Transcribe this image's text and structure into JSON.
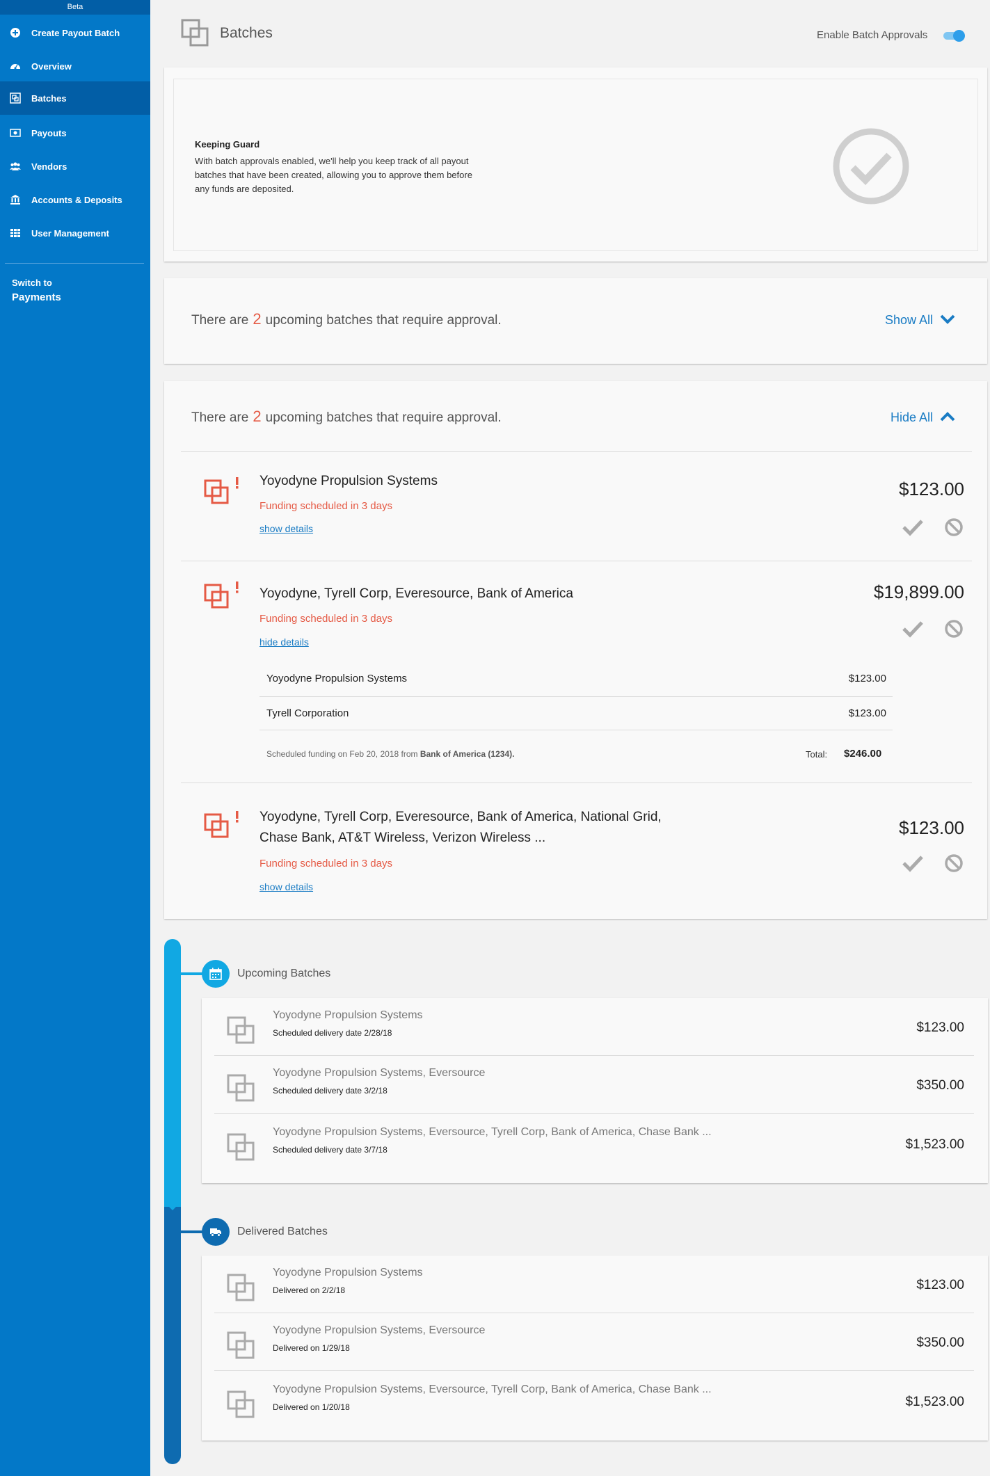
{
  "sidebar": {
    "beta": "Beta",
    "items": [
      {
        "label": "Create Payout Batch",
        "icon": "plus-circle-icon"
      },
      {
        "label": "Overview",
        "icon": "dashboard-icon"
      },
      {
        "label": "Batches",
        "icon": "batches-icon",
        "active": true
      },
      {
        "label": "Payouts",
        "icon": "money-icon"
      },
      {
        "label": "Vendors",
        "icon": "users-icon"
      },
      {
        "label": "Accounts & Deposits",
        "icon": "bank-icon"
      },
      {
        "label": "User Management",
        "icon": "grid-icon"
      }
    ],
    "switch_to": "Switch to",
    "switch_target": "Payments"
  },
  "header": {
    "title": "Batches",
    "toggle_label": "Enable Batch Approvals",
    "toggle_on": true
  },
  "guard": {
    "title": "Keeping Guard",
    "text": "With batch approvals enabled, we'll help you  keep track of all payout batches that have been created, allowing you to approve them before any funds are deposited."
  },
  "collapsed": {
    "prefix": "There are",
    "count": "2",
    "suffix": "upcoming batches that require approval.",
    "link": "Show All"
  },
  "expanded": {
    "prefix": "There are",
    "count": "2",
    "suffix": "upcoming batches that require approval.",
    "link": "Hide All",
    "batches": [
      {
        "title": "Yoyodyne Propulsion Systems",
        "status": "Funding scheduled in 3 days",
        "link": "show details",
        "amount": "$123.00"
      },
      {
        "title": "Yoyodyne, Tyrell Corp, Everesource, Bank of America",
        "status": "Funding scheduled in 3 days",
        "link": "hide details",
        "amount": "$19,899.00",
        "details": [
          {
            "name": "Yoyodyne Propulsion Systems",
            "amount": "$123.00"
          },
          {
            "name": "Tyrell Corporation",
            "amount": "$123.00"
          }
        ],
        "note_prefix": "Scheduled funding on Feb 20, 2018 from",
        "note_bank": "Bank of America (1234).",
        "total_label": "Total:",
        "total": "$246.00"
      },
      {
        "title_line1": "Yoyodyne, Tyrell Corp, Everesource, Bank of America, National Grid,",
        "title_line2": "Chase Bank, AT&T Wireless, Verizon Wireless ...",
        "status": "Funding scheduled in 3 days",
        "link": "show details",
        "amount": "$123.00"
      }
    ]
  },
  "upcoming": {
    "label": "Upcoming Batches",
    "rows": [
      {
        "name": "Yoyodyne Propulsion Systems",
        "sub": "Scheduled delivery date 2/28/18",
        "amount": "$123.00"
      },
      {
        "name": "Yoyodyne Propulsion Systems, Eversource",
        "sub": "Scheduled delivery date 3/2/18",
        "amount": "$350.00"
      },
      {
        "name": "Yoyodyne Propulsion Systems, Eversource, Tyrell Corp, Bank of America, Chase Bank ...",
        "sub": "Scheduled delivery date 3/7/18",
        "amount": "$1,523.00"
      }
    ]
  },
  "delivered": {
    "label": "Delivered Batches",
    "rows": [
      {
        "name": "Yoyodyne Propulsion Systems",
        "sub": "Delivered on 2/2/18",
        "amount": "$123.00"
      },
      {
        "name": "Yoyodyne Propulsion Systems, Eversource",
        "sub": "Delivered on 1/29/18",
        "amount": "$350.00"
      },
      {
        "name": "Yoyodyne Propulsion Systems, Eversource, Tyrell Corp, Bank of America, Chase Bank ...",
        "sub": "Delivered on 1/20/18",
        "amount": "$1,523.00"
      }
    ]
  },
  "colors": {
    "sidebar": "#0378c8",
    "sidebar_active": "#025ea6",
    "accent": "#1a7cc4",
    "alert": "#e55a45",
    "timeline_upcoming": "#11a8e3",
    "timeline_delivered": "#0e6bb0"
  }
}
